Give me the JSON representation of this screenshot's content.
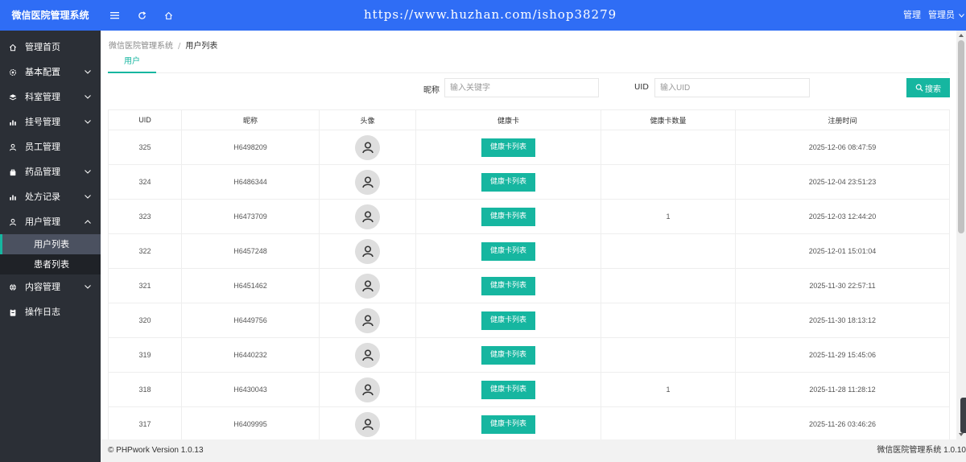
{
  "header": {
    "logo": "微信医院管理系统",
    "watermark": "https://www.huzhan.com/ishop38279",
    "manage": "管理",
    "admin": "管理员"
  },
  "sidebar": {
    "items": [
      {
        "label": "管理首页",
        "icon": "home-icon"
      },
      {
        "label": "基本配置",
        "icon": "gear-icon"
      },
      {
        "label": "科室管理",
        "icon": "layers-icon"
      },
      {
        "label": "挂号管理",
        "icon": "chart-icon"
      },
      {
        "label": "员工管理",
        "icon": "user-icon"
      },
      {
        "label": "药品管理",
        "icon": "bag-icon"
      },
      {
        "label": "处方记录",
        "icon": "chart-icon"
      },
      {
        "label": "用户管理",
        "icon": "user-icon"
      }
    ],
    "sub_items": [
      {
        "label": "用户列表",
        "active": true
      },
      {
        "label": "患者列表",
        "active": false
      }
    ],
    "items_after": [
      {
        "label": "内容管理",
        "icon": "globe-icon"
      },
      {
        "label": "操作日志",
        "icon": "clipboard-icon"
      }
    ]
  },
  "breadcrumb": {
    "root": "微信医院管理系统",
    "sep": "/",
    "current": "用户列表"
  },
  "tab": {
    "label": "用户"
  },
  "filters": {
    "nickname_label": "昵称",
    "nickname_placeholder": "输入关键字",
    "uid_label": "UID",
    "uid_placeholder": "输入UID",
    "search_label": "搜索"
  },
  "table": {
    "headers": [
      "UID",
      "昵称",
      "头像",
      "健康卡",
      "健康卡数量",
      "注册时间"
    ],
    "card_button": "健康卡列表",
    "rows": [
      {
        "uid": "325",
        "nickname": "H6498209",
        "count": "",
        "time": "2025-12-06 08:47:59"
      },
      {
        "uid": "324",
        "nickname": "H6486344",
        "count": "",
        "time": "2025-12-04 23:51:23"
      },
      {
        "uid": "323",
        "nickname": "H6473709",
        "count": "1",
        "time": "2025-12-03 12:44:20"
      },
      {
        "uid": "322",
        "nickname": "H6457248",
        "count": "",
        "time": "2025-12-01 15:01:04"
      },
      {
        "uid": "321",
        "nickname": "H6451462",
        "count": "",
        "time": "2025-11-30 22:57:11"
      },
      {
        "uid": "320",
        "nickname": "H6449756",
        "count": "",
        "time": "2025-11-30 18:13:12"
      },
      {
        "uid": "319",
        "nickname": "H6440232",
        "count": "",
        "time": "2025-11-29 15:45:06"
      },
      {
        "uid": "318",
        "nickname": "H6430043",
        "count": "1",
        "time": "2025-11-28 11:28:12"
      },
      {
        "uid": "317",
        "nickname": "H6409995",
        "count": "",
        "time": "2025-11-26 03:46:26"
      }
    ]
  },
  "footer": {
    "left": "© PHPwork Version 1.0.13",
    "right": "微信医院管理系统 1.0.10"
  },
  "colors": {
    "header": "#2f6df5",
    "sidebar": "#2b2f36",
    "accent": "#16b6a0"
  }
}
